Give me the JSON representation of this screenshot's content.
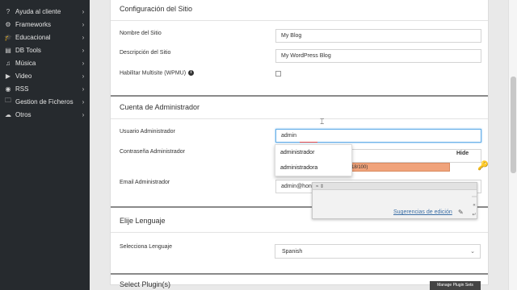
{
  "sidebar": {
    "items": [
      {
        "label": "Ayuda al cliente",
        "icon": "help-icon",
        "glyph": "?"
      },
      {
        "label": "Frameworks",
        "icon": "gears-icon",
        "glyph": "⚙"
      },
      {
        "label": "Educacional",
        "icon": "graduation-cap-icon",
        "glyph": "🎓"
      },
      {
        "label": "DB Tools",
        "icon": "database-icon",
        "glyph": "▤"
      },
      {
        "label": "Música",
        "icon": "music-icon",
        "glyph": "♫"
      },
      {
        "label": "Video",
        "icon": "video-icon",
        "glyph": "▶"
      },
      {
        "label": "RSS",
        "icon": "rss-icon",
        "glyph": "◉"
      },
      {
        "label": "Gestion de Ficheros",
        "icon": "file-manager-icon",
        "glyph": "🗀"
      },
      {
        "label": "Otros",
        "icon": "cloud-icon",
        "glyph": "☁"
      }
    ]
  },
  "site_config": {
    "title": "Configuración del Sitio",
    "site_name_label": "Nombre del Sitio",
    "site_name_value": "My Blog",
    "site_desc_label": "Descripción del Sitio",
    "site_desc_value": "My WordPress Blog",
    "multisite_label": "Habilitar Multisite (WPMU)"
  },
  "admin": {
    "title": "Cuenta de Administrador",
    "user_label": "Usuario Administrador",
    "user_value": "admin",
    "password_label": "Contraseña Administrador",
    "strength_text": "d (18/100)",
    "hide_label": "Hide",
    "email_label": "Email Administrador",
    "email_value": "admin@hon"
  },
  "autocomplete": {
    "options": [
      "administrador",
      "administradora"
    ]
  },
  "spell_popup": {
    "header": "≈ ⇕",
    "link": "Sugerencias de edición"
  },
  "language": {
    "title": "Elije Lenguaje",
    "select_label": "Selecciona Lenguaje",
    "selected": "Spanish"
  },
  "plugins": {
    "title": "Select Plugin(s)",
    "button": "Manage Plugin Sets"
  },
  "colors": {
    "sidebar_bg": "#262a2e",
    "strength_bar": "#f0a37b",
    "focus": "#66afe9"
  }
}
